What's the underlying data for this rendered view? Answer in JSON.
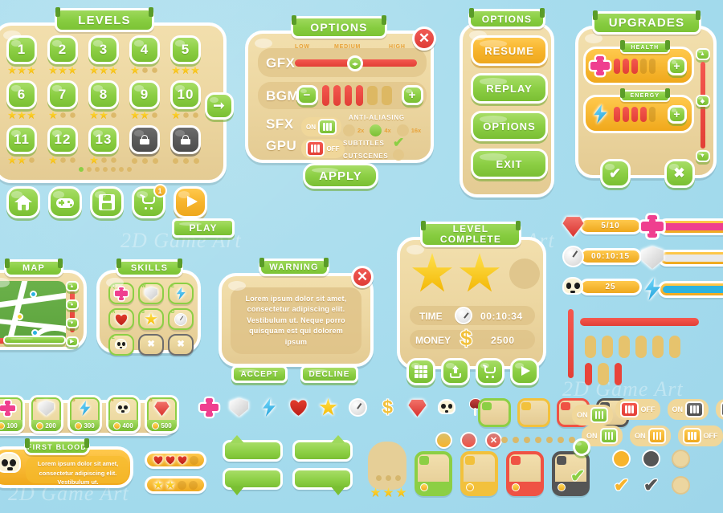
{
  "theme": {
    "background": "#a8dced",
    "panel_fill": "#ecd6a0",
    "green": "#8ccf44",
    "orange": "#f7b42c",
    "red": "#e23f36",
    "pink": "#ef3f8f",
    "blue": "#2bb3e0",
    "gray": "#4d4d4d"
  },
  "watermark": "2D Game Art",
  "levels_panel": {
    "title": "LEVELS",
    "levels": [
      {
        "label": "1",
        "stars": 3,
        "locked": false
      },
      {
        "label": "2",
        "stars": 3,
        "locked": false
      },
      {
        "label": "3",
        "stars": 3,
        "locked": false
      },
      {
        "label": "4",
        "stars": 1,
        "locked": false
      },
      {
        "label": "5",
        "stars": 3,
        "locked": false
      },
      {
        "label": "6",
        "stars": 3,
        "locked": false
      },
      {
        "label": "7",
        "stars": 1,
        "locked": false
      },
      {
        "label": "8",
        "stars": 2,
        "locked": false
      },
      {
        "label": "9",
        "stars": 2,
        "locked": false
      },
      {
        "label": "10",
        "stars": 1,
        "locked": false
      },
      {
        "label": "11",
        "stars": 2,
        "locked": false
      },
      {
        "label": "12",
        "stars": 1,
        "locked": false
      },
      {
        "label": "13",
        "stars": 1,
        "locked": false
      },
      {
        "label": "",
        "stars": 0,
        "locked": true
      },
      {
        "label": "",
        "stars": 0,
        "locked": true
      }
    ],
    "pager_dots": 7,
    "pager_active": 0,
    "next_icon": "arrow-right-icon"
  },
  "bottom_nav": {
    "buttons": [
      {
        "icon": "home-icon",
        "name": "home-button"
      },
      {
        "icon": "gamepad-icon",
        "name": "gamepad-button"
      },
      {
        "icon": "save-icon",
        "name": "save-button"
      },
      {
        "icon": "cart-icon",
        "name": "shop-button",
        "badge": "1"
      },
      {
        "icon": "play-icon",
        "name": "play-round-button"
      }
    ],
    "play_label": "PLAY"
  },
  "options_panel": {
    "title": "OPTIONS",
    "close_label": "✕",
    "gfx": {
      "label": "GFX",
      "ticks": [
        "LOW",
        "MEDIUM",
        "HIGH"
      ],
      "value": "MEDIUM",
      "percent": 48
    },
    "bgm": {
      "label": "BGM",
      "minus": "−",
      "plus": "+",
      "filled": 4,
      "total": 6
    },
    "sfx": {
      "label": "SFX",
      "state": "ON"
    },
    "gpu": {
      "label": "GPU",
      "state": "OFF"
    },
    "antialiasing": {
      "label": "ANTI-ALIASING",
      "options": [
        "2x",
        "4x",
        "16x"
      ],
      "selected": "4x"
    },
    "subtitles": {
      "label": "SUBTITLES",
      "checked": true
    },
    "cutscenes": {
      "label": "CUTSCENES",
      "checked": false
    },
    "apply_label": "APPLY"
  },
  "pause_panel": {
    "title": "OPTIONS",
    "buttons": [
      {
        "label": "RESUME",
        "style": "orange"
      },
      {
        "label": "REPLAY",
        "style": "green"
      },
      {
        "label": "OPTIONS",
        "style": "green"
      },
      {
        "label": "EXIT",
        "style": "green"
      }
    ]
  },
  "upgrades_panel": {
    "title": "UPGRADES",
    "rows": [
      {
        "label": "HEALTH",
        "icon": "cross-icon",
        "filled": 3,
        "total": 5,
        "plus": "+"
      },
      {
        "label": "ENERGY",
        "icon": "bolt-icon",
        "filled": 4,
        "total": 5,
        "plus": "+"
      }
    ],
    "confirm_icon": "check-icon",
    "cancel_icon": "close-icon",
    "scroll_up": "▲",
    "scroll_down": "▼"
  },
  "map_panel": {
    "title": "MAP",
    "pins": [
      "blue",
      "pink",
      "yellow",
      "blue"
    ],
    "rail_buttons": [
      "▲",
      "●",
      "▼",
      "▶"
    ]
  },
  "skills_panel": {
    "title": "SKILLS",
    "slots": [
      {
        "key": "Q",
        "icon": "cross-icon",
        "locked": false
      },
      {
        "key": "W",
        "icon": "shield-icon",
        "locked": false
      },
      {
        "key": "E",
        "icon": "bolt-icon",
        "locked": false
      },
      {
        "key": "A",
        "icon": "heart-icon",
        "locked": false
      },
      {
        "key": "S",
        "icon": "star-icon",
        "locked": false
      },
      {
        "key": "D",
        "icon": "clock-icon",
        "locked": false
      },
      {
        "key": "Z",
        "icon": "skull-icon",
        "locked": false
      },
      {
        "key": "",
        "icon": "close-icon",
        "locked": true
      },
      {
        "key": "",
        "icon": "close-icon",
        "locked": true
      }
    ]
  },
  "warning_dialog": {
    "title": "WARNING",
    "close_label": "✕",
    "body": "Lorem ipsum dolor sit amet, consectetur adipiscing elit. Vestibulum ut. Neque porro quisquam est qui dolorem ipsum",
    "accept_label": "ACCEPT",
    "decline_label": "DECLINE"
  },
  "level_complete_panel": {
    "title_line1": "LEVEL",
    "title_line2": "COMPLETE",
    "stars_earned": 2,
    "stars_total": 3,
    "time": {
      "label": "TIME",
      "icon": "clock-icon",
      "value": "00:10:34"
    },
    "money": {
      "label": "MONEY",
      "icon": "coin-icon",
      "value": "2500"
    },
    "actions": [
      {
        "icon": "grid-icon",
        "name": "levels-grid-button"
      },
      {
        "icon": "share-icon",
        "name": "share-button"
      },
      {
        "icon": "cart-icon",
        "name": "shop-button"
      },
      {
        "icon": "play-icon",
        "name": "next-level-button"
      }
    ]
  },
  "hud_stats": [
    {
      "icon": "gem-icon",
      "value": "5/10",
      "fill": "#f7b42c"
    },
    {
      "icon": "clock-icon",
      "value": "00:10:15",
      "fill": "#f7b42c"
    },
    {
      "icon": "skull-icon",
      "value": "25",
      "fill": "#f7b42c"
    }
  ],
  "hud_bars": [
    {
      "icon": "cross-icon",
      "fill": "#ef3f8f",
      "percent": 100
    },
    {
      "icon": "shield-icon",
      "fill": "#e8e8e8",
      "percent": 100
    },
    {
      "icon": "bolt-icon",
      "fill": "#2bb3e0",
      "percent": 100
    }
  ],
  "cost_row": [
    {
      "index": "1",
      "icon": "cross-icon",
      "cost": "100"
    },
    {
      "index": "2",
      "icon": "shield-icon",
      "cost": "200"
    },
    {
      "index": "3",
      "icon": "bolt-icon",
      "cost": "300"
    },
    {
      "index": "4",
      "icon": "skull-icon",
      "cost": "400"
    },
    {
      "index": "5",
      "icon": "gem-icon",
      "cost": "500"
    }
  ],
  "achievement": {
    "title": "FIRST BLOOD",
    "icon": "skull-icon",
    "body": "Lorem ipsum dolor sit amet, consectetur adipiscing elit. Vestibulum ut."
  },
  "meters": [
    {
      "name": "lives-meter",
      "icon": "heart-icon",
      "filled": 3,
      "total": 4
    },
    {
      "name": "rating-meter",
      "icon": "star-icon",
      "filled": 2,
      "total": 4
    }
  ],
  "icon_strip": [
    "cross-icon",
    "shield-icon",
    "bolt-icon",
    "heart-icon",
    "star-icon",
    "clock-icon",
    "coin-icon",
    "gem-icon",
    "skull-icon",
    "meat-icon"
  ],
  "tab_strip": [
    {
      "name": "tab-green",
      "color": "#8ccf44"
    },
    {
      "name": "tab-yellow",
      "color": "#f2c13c"
    },
    {
      "name": "tab-red",
      "color": "#ef5244"
    },
    {
      "name": "tab-gray",
      "color": "#555555"
    }
  ],
  "item_cards": [
    {
      "name": "card-green",
      "color": "#8ccf44"
    },
    {
      "name": "card-yellow",
      "color": "#f2c13c"
    },
    {
      "name": "card-red",
      "color": "#ef5244"
    },
    {
      "name": "card-gray",
      "color": "#555555"
    }
  ],
  "bullet_dots": 7,
  "status_dots": [
    {
      "name": "dot-yellow",
      "color": "#f7b42c"
    },
    {
      "name": "dot-red",
      "color": "#ef5244"
    },
    {
      "name": "dot-close",
      "color": "#ef5244",
      "glyph": "✕"
    }
  ],
  "toggles_top": [
    {
      "state": "OFF",
      "eq": "red",
      "side": "left"
    },
    {
      "state": "ON",
      "eq": "gray",
      "side": "right"
    },
    {
      "state": "OFF",
      "eq": "gray",
      "side": "left"
    }
  ],
  "toggles_bottom": [
    {
      "state": "ON",
      "eq": "green",
      "side": "right"
    },
    {
      "state": "ON",
      "eq": "yellow",
      "side": "right"
    },
    {
      "state": "OFF",
      "eq": "yellow",
      "side": "left"
    }
  ],
  "swatch_rows": [
    [
      {
        "name": "radio-yellow-on",
        "fill": "#f7b42c"
      },
      {
        "name": "radio-gray-on",
        "fill": "#555555"
      },
      {
        "name": "radio-empty",
        "fill": "#ecd6a0"
      }
    ],
    [
      {
        "name": "check-yellow",
        "fill": "#f7b42c",
        "glyph": "✔"
      },
      {
        "name": "check-gray",
        "fill": "#555555",
        "glyph": "✔"
      },
      {
        "name": "check-empty",
        "fill": "#ecd6a0",
        "glyph": ""
      }
    ]
  ],
  "side_toggle": {
    "state": "ON"
  },
  "speech_bubbles": 4,
  "avatar_frame": {
    "stars": 3
  },
  "bars_loose": {
    "vertical": 1,
    "horizontal": 1,
    "pills_empty": 6,
    "pills_mixed": 3
  }
}
